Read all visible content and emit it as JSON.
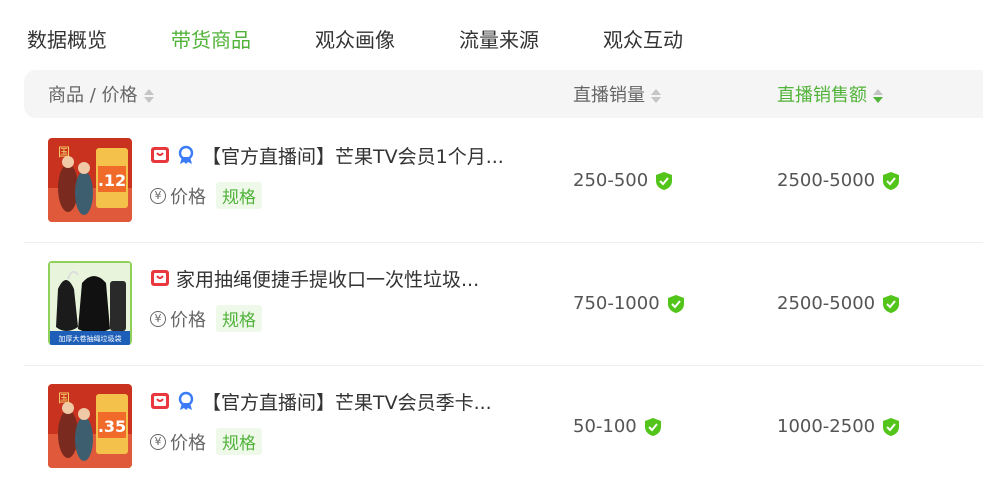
{
  "tabs": [
    {
      "label": "数据概览",
      "active": false
    },
    {
      "label": "带货商品",
      "active": true
    },
    {
      "label": "观众画像",
      "active": false
    },
    {
      "label": "流量来源",
      "active": false
    },
    {
      "label": "观众互动",
      "active": false
    }
  ],
  "table": {
    "headers": {
      "product": "商品 / 价格",
      "sales_volume": "直播销量",
      "sales_amount": "直播销售额"
    },
    "sort": {
      "column": "sales_amount",
      "direction": "desc"
    },
    "rows": [
      {
        "title": "【官方直播间】芒果TV会员1个月...",
        "price_label": "价格",
        "spec_label": "规格",
        "badges": [
          "shop-bag-icon",
          "award-ribbon-icon"
        ],
        "thumb_text": ".12",
        "sales_volume": "250-500",
        "sales_amount": "2500-5000"
      },
      {
        "title": "家用抽绳便捷手提收口一次性垃圾...",
        "price_label": "价格",
        "spec_label": "规格",
        "badges": [
          "shop-bag-icon"
        ],
        "thumb_text": "加厚大卷抽绳垃圾袋",
        "sales_volume": "750-1000",
        "sales_amount": "2500-5000"
      },
      {
        "title": "【官方直播间】芒果TV会员季卡...",
        "price_label": "价格",
        "spec_label": "规格",
        "badges": [
          "shop-bag-icon",
          "award-ribbon-icon"
        ],
        "thumb_text": ".35",
        "sales_volume": "50-100",
        "sales_amount": "1000-2500"
      }
    ]
  },
  "colors": {
    "accent": "#52b33a",
    "verified": "#52c41a",
    "badge_red": "#e8383d",
    "badge_blue": "#3b7cf6"
  }
}
